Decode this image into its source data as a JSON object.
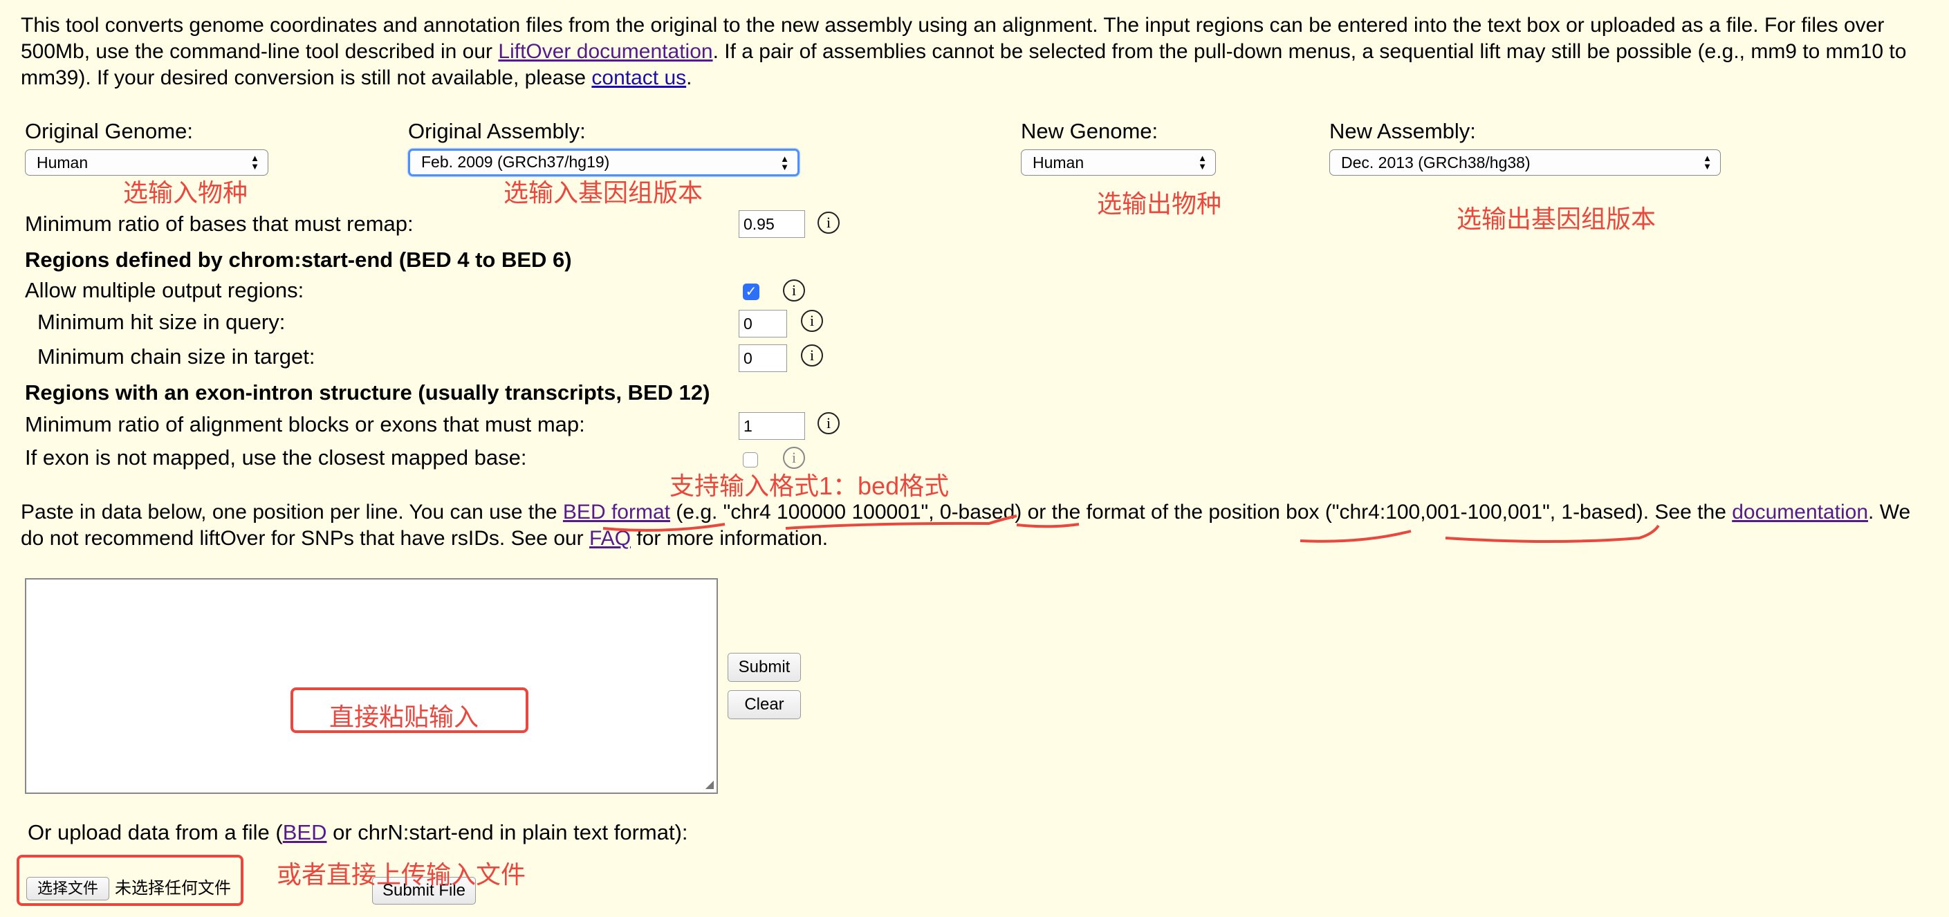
{
  "intro": {
    "p1": "This tool converts genome coordinates and annotation files from the original to the new assembly using an alignment.  The input regions can be entered into the text box or uploaded as a file.  For files over 500Mb, use the command-line tool described in our ",
    "link1": "LiftOver documentation",
    "p2": ".  If a pair of assemblies cannot be selected from the pull-down menus, a sequential lift may still be possible (e.g., mm9 to mm10 to mm39).  If your desired conversion is still not available, please ",
    "link2": "contact us",
    "p3": "."
  },
  "selectors": {
    "orig_genome_label": "Original Genome:",
    "orig_genome_value": "Human",
    "orig_assembly_label": "Original Assembly:",
    "orig_assembly_value": "Feb. 2009 (GRCh37/hg19)",
    "new_genome_label": "New Genome:",
    "new_genome_value": "Human",
    "new_assembly_label": "New Assembly:",
    "new_assembly_value": "Dec. 2013 (GRCh38/hg38)"
  },
  "options": {
    "min_ratio_label": "Minimum ratio of bases that must remap:",
    "min_ratio_value": "0.95",
    "bed4_heading": "Regions defined by chrom:start-end (BED 4 to BED 6)",
    "allow_multiple_label": "Allow multiple output regions:",
    "allow_multiple_checked": true,
    "min_hit_label": "Minimum hit size in query:",
    "min_hit_value": "0",
    "min_chain_label": "Minimum chain size in target:",
    "min_chain_value": "0",
    "bed12_heading": "Regions with an exon-intron structure (usually transcripts, BED 12)",
    "min_blocks_label": "Minimum ratio of alignment blocks or exons that must map:",
    "min_blocks_value": "1",
    "exon_closest_label": "If exon is not mapped, use the closest mapped base:",
    "exon_closest_checked": false,
    "info_glyph": "i"
  },
  "paste": {
    "p1": "Paste in data below, one position per line. You can use the ",
    "bed_link": "BED format",
    "p2": " (e.g. \"chr4 100000 100001\", 0-based) or the format of the position box (\"chr4:100,001-100,001\", 1-based). See the ",
    "doc_link": "documentation",
    "p3": ". We do not recommend liftOver for SNPs that have rsIDs. See our ",
    "faq_link": "FAQ",
    "p4": " for more information.",
    "submit_label": "Submit",
    "clear_label": "Clear"
  },
  "upload": {
    "p1": "Or upload data from a file (",
    "bed_link": "BED",
    "p2": " or chrN:start-end in plain text format):",
    "choose_label": "选择文件",
    "no_file_label": "未选择任何文件",
    "submit_file_label": "Submit File"
  },
  "annotations": {
    "input_species": "选输入物种",
    "input_assembly": "选输入基因组版本",
    "output_species": "选输出物种",
    "output_assembly": "选输出基因组版本",
    "format_note": "支持输入格式1：bed格式",
    "paste_input": "直接粘贴输入",
    "upload_input": "或者直接上传输入文件",
    "annotation_color": "#e9483e"
  }
}
